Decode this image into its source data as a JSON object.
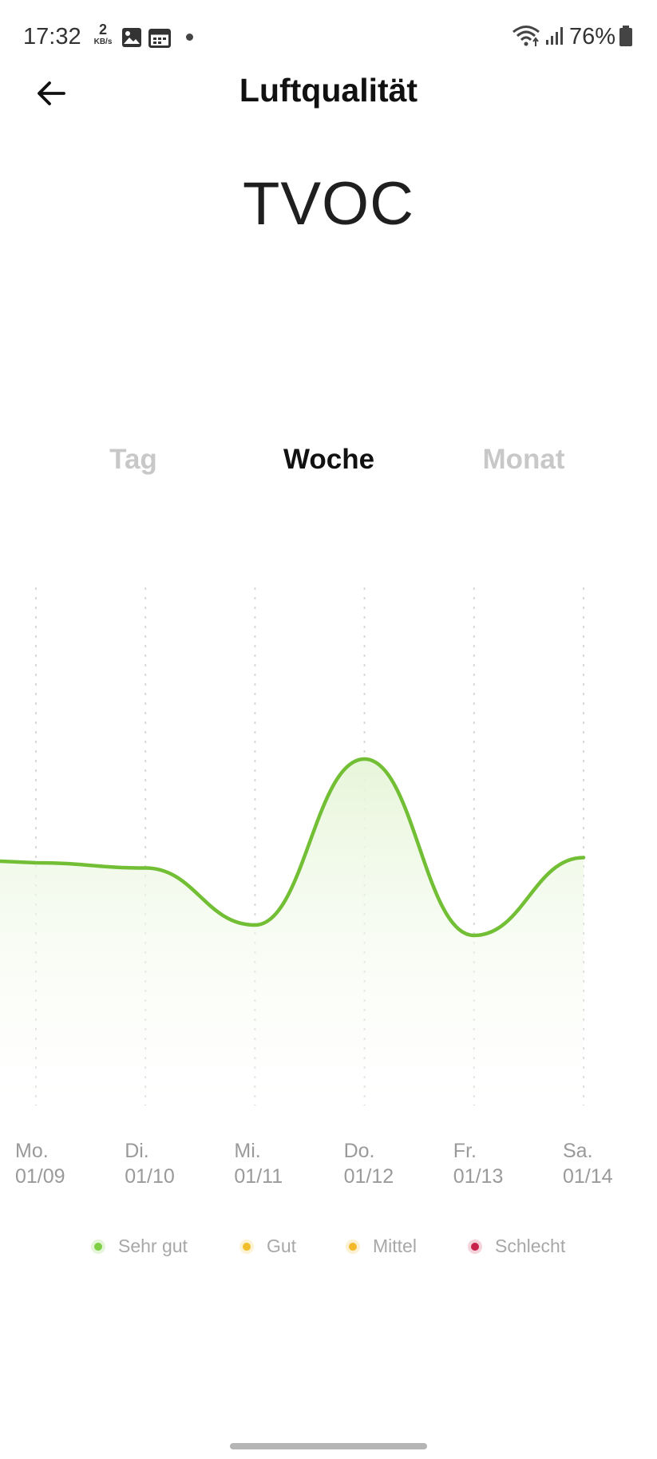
{
  "status_bar": {
    "time": "17:32",
    "net_speed_value": "2",
    "net_speed_unit": "KB/s",
    "battery_percent": "76%"
  },
  "header": {
    "title": "Luftqualität"
  },
  "metric": {
    "title": "TVOC"
  },
  "tabs": [
    {
      "label": "Tag",
      "active": false
    },
    {
      "label": "Woche",
      "active": true
    },
    {
      "label": "Monat",
      "active": false
    }
  ],
  "chart_data": {
    "type": "area",
    "x": [
      {
        "day": "Mo.",
        "date": "01/09"
      },
      {
        "day": "Di.",
        "date": "01/10"
      },
      {
        "day": "Mi.",
        "date": "01/11"
      },
      {
        "day": "Do.",
        "date": "01/12"
      },
      {
        "day": "Fr.",
        "date": "01/13"
      },
      {
        "day": "Sa.",
        "date": "01/14"
      }
    ],
    "values": [
      0.46,
      0.45,
      0.34,
      0.66,
      0.32,
      0.47
    ],
    "value_range": [
      0,
      1
    ],
    "line_color": "#72bf35",
    "fill_color": "#e9f6dd",
    "grid_color": "#d8d8d8"
  },
  "legend": [
    {
      "label": "Sehr gut",
      "color": "#7fcf45"
    },
    {
      "label": "Gut",
      "color": "#f0be2a"
    },
    {
      "label": "Mittel",
      "color": "#f3b92a"
    },
    {
      "label": "Schlecht",
      "color": "#c8224a"
    }
  ]
}
